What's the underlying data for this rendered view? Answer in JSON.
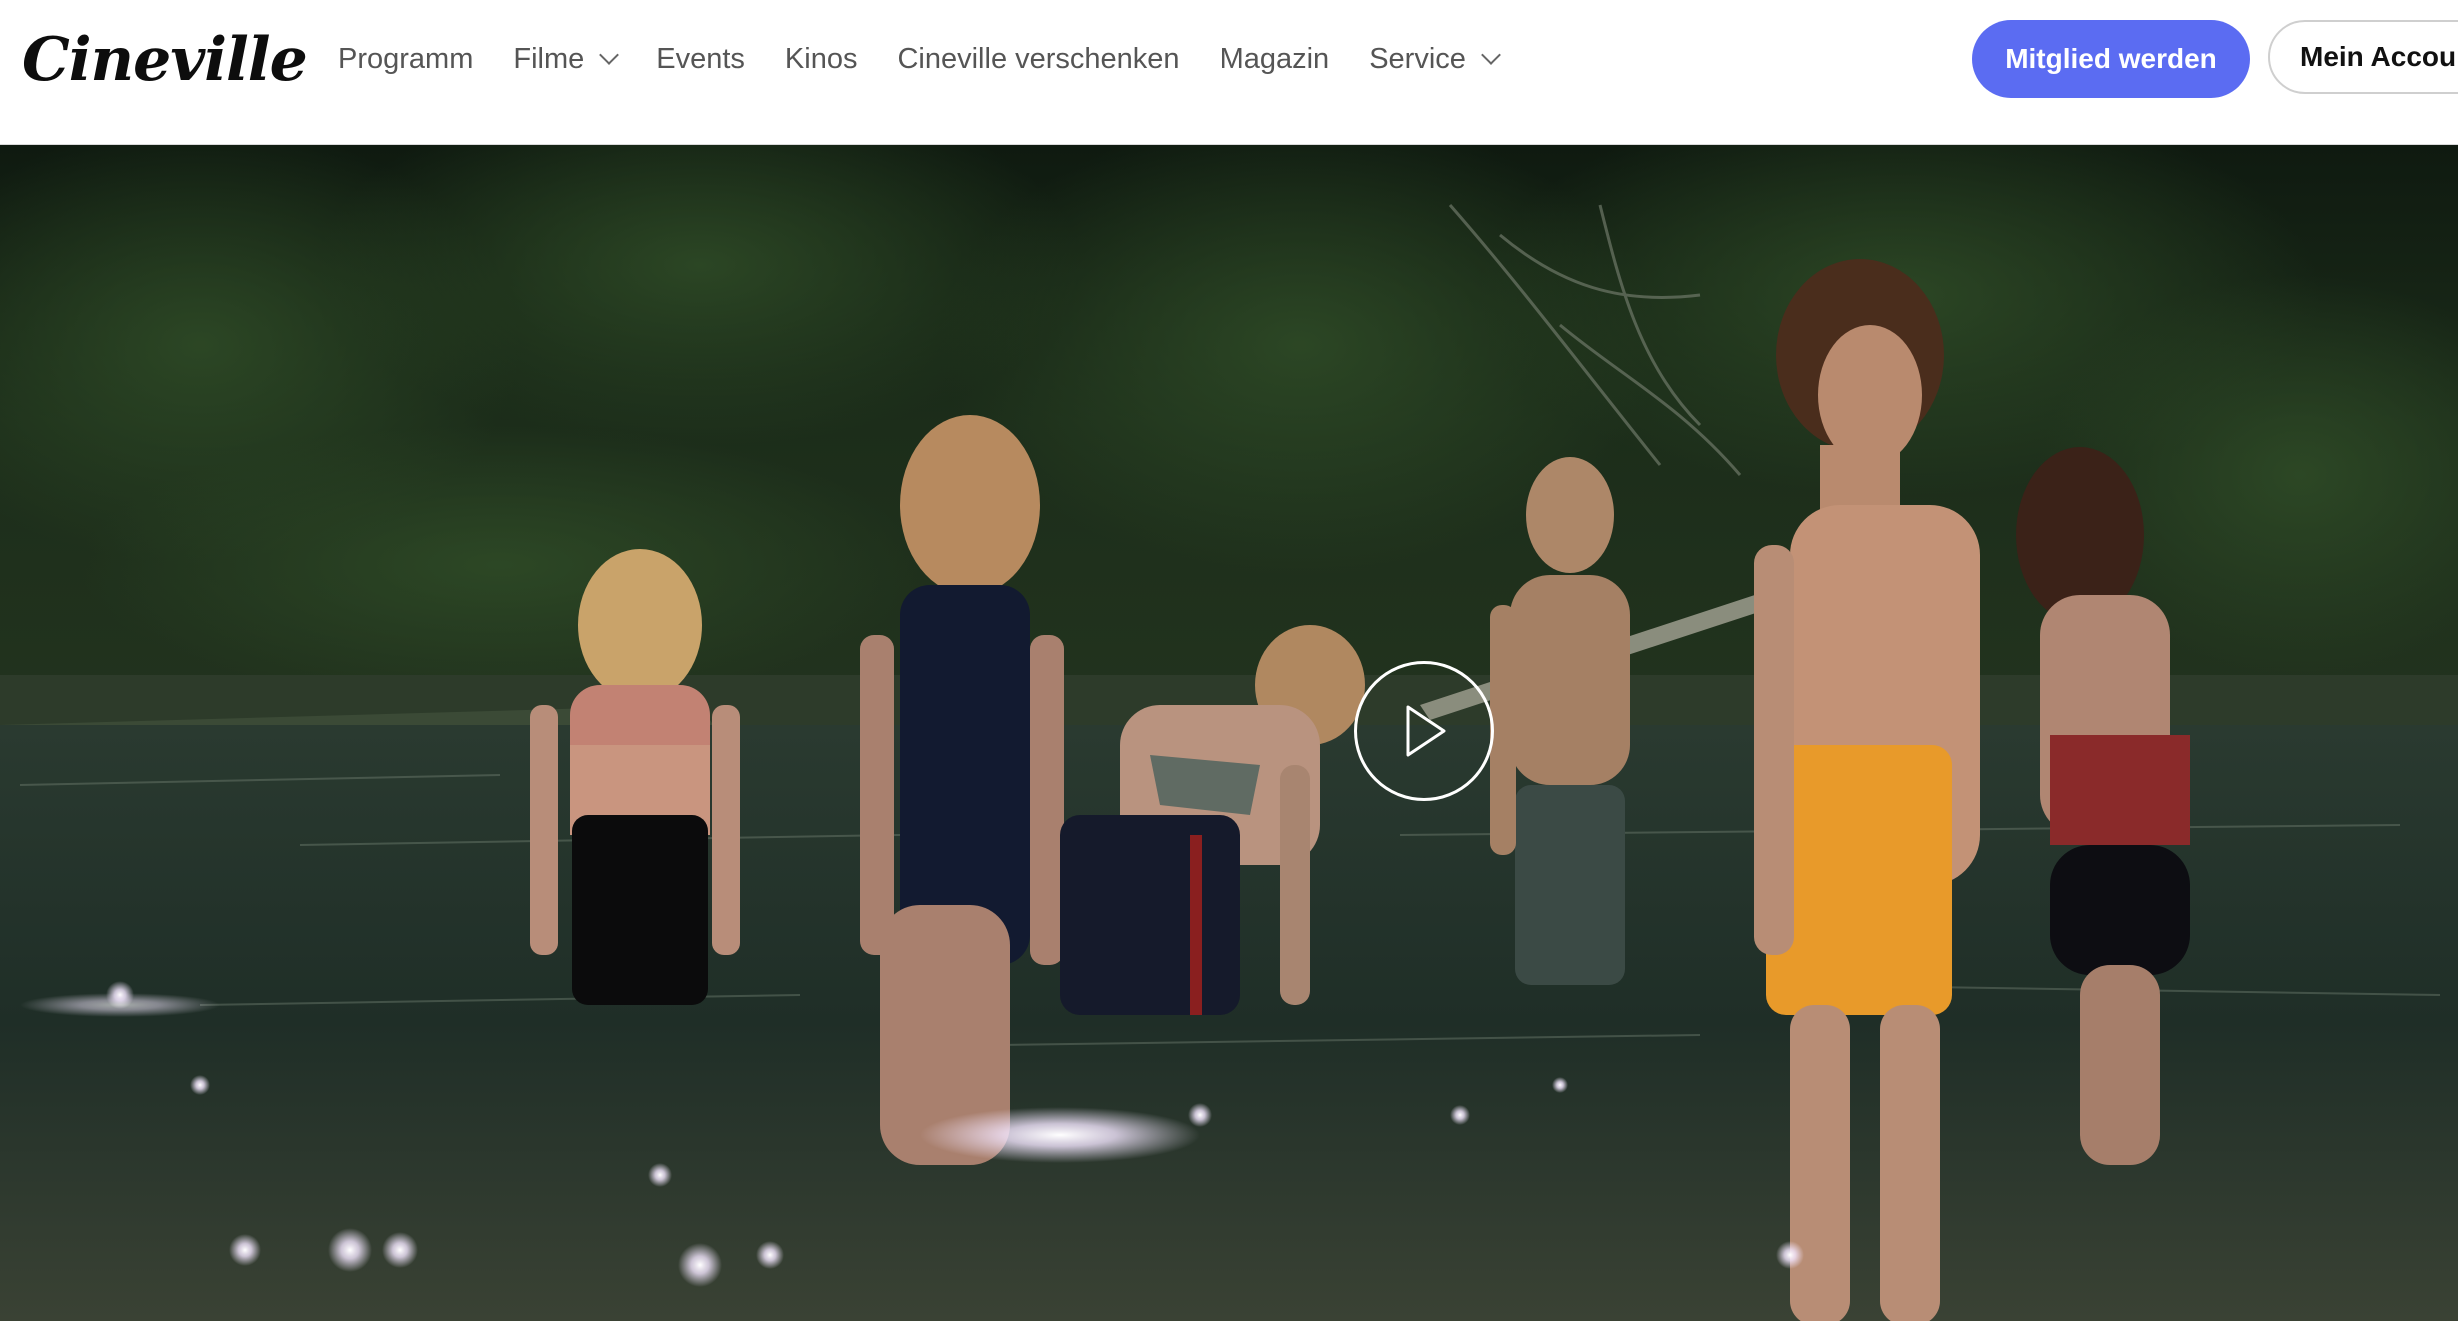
{
  "brand": {
    "logo_text": "Cineville"
  },
  "nav": {
    "items": [
      {
        "label": "Programm",
        "has_dropdown": false
      },
      {
        "label": "Filme",
        "has_dropdown": true
      },
      {
        "label": "Events",
        "has_dropdown": false
      },
      {
        "label": "Kinos",
        "has_dropdown": false
      },
      {
        "label": "Cineville verschenken",
        "has_dropdown": false
      },
      {
        "label": "Magazin",
        "has_dropdown": false
      },
      {
        "label": "Service",
        "has_dropdown": true
      }
    ]
  },
  "header_actions": {
    "primary_label": "Mitglied werden",
    "secondary_label": "Mein Accour"
  },
  "hero": {
    "media": "video-still",
    "play_icon": "play-icon"
  },
  "colors": {
    "accent": "#5b6cf2",
    "nav_text": "#555555",
    "header_bg": "#ffffff"
  }
}
